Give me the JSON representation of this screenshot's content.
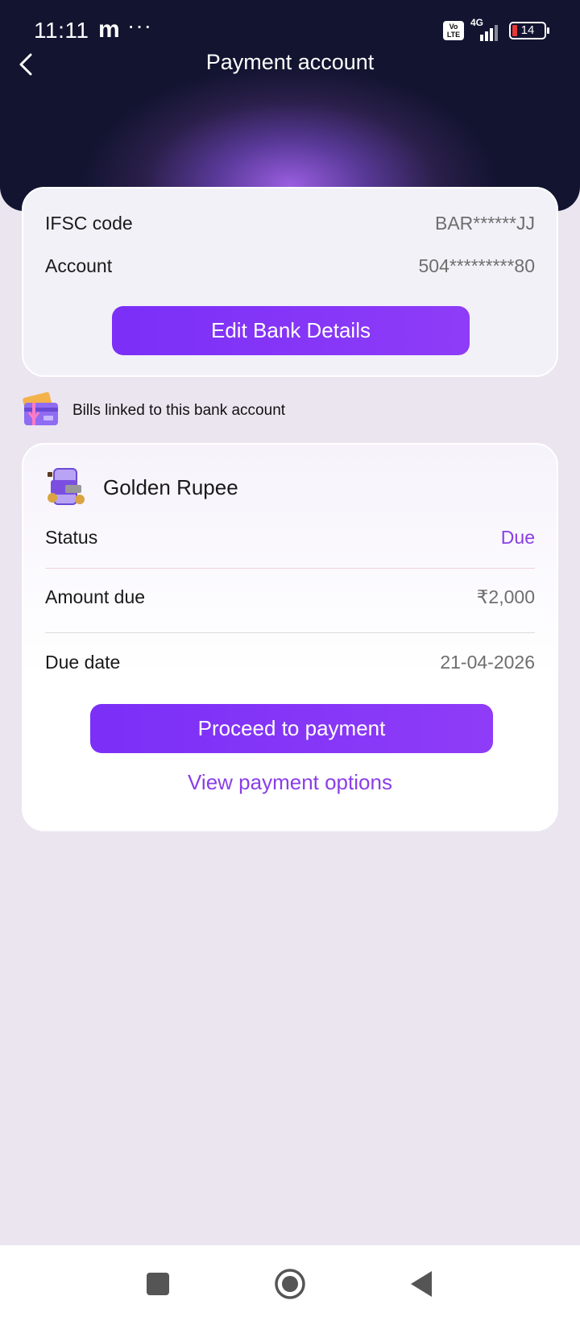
{
  "status_bar": {
    "time": "11:11",
    "app_icon": "m",
    "more": "···",
    "volte": "Vo LTE",
    "network": "4G",
    "battery": "14"
  },
  "header": {
    "title": "Payment account",
    "back_icon": "chevron-left-icon"
  },
  "bank_details": {
    "ifsc_label": "IFSC code",
    "ifsc_value": "BAR******JJ",
    "account_label": "Account",
    "account_value": "504*********80",
    "edit_button": "Edit Bank Details"
  },
  "bills_section": {
    "heading": "Bills linked to this bank account",
    "icon": "credit-cards-icon"
  },
  "bill": {
    "biller_name": "Golden Rupee",
    "status_label": "Status",
    "status_value": "Due",
    "amount_label": "Amount due",
    "amount_value": "₹2,000",
    "due_date_label": "Due date",
    "due_date_value": "21-04-2026",
    "proceed_button": "Proceed to payment",
    "view_options_link": "View payment options"
  },
  "nav_bar": {
    "items": [
      "recent-apps-icon",
      "home-icon",
      "back-icon"
    ]
  },
  "colors": {
    "accent": "#7b2ff7",
    "link": "#8a3ee8",
    "background": "#ebe5f0"
  }
}
